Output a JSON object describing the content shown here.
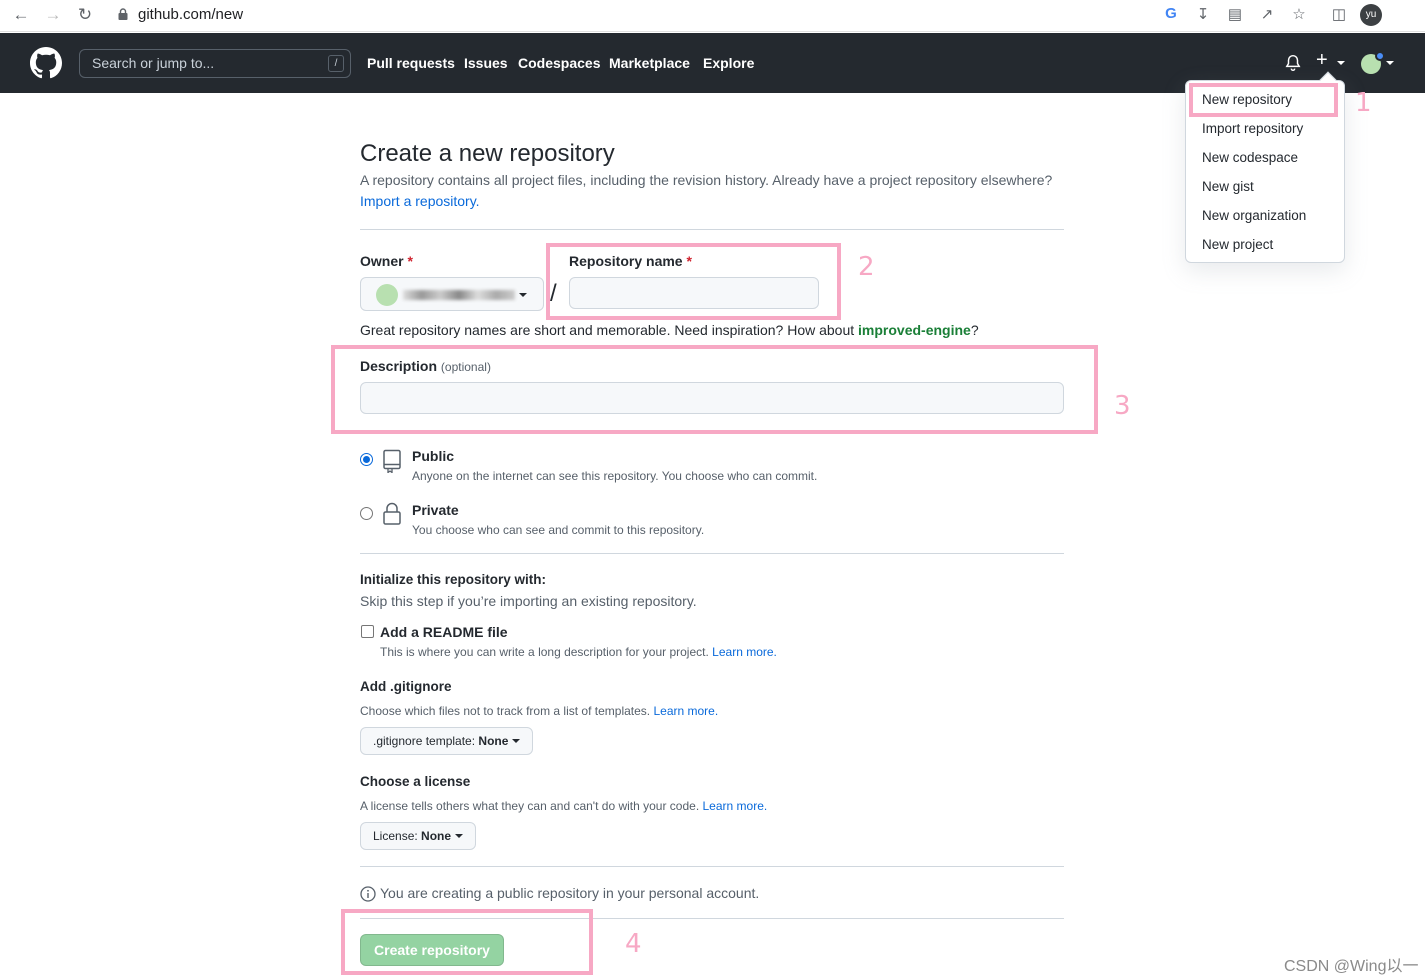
{
  "browser": {
    "url": "github.com/new",
    "profile_initials": "yu"
  },
  "header": {
    "search_placeholder": "Search or jump to...",
    "search_shortcut": "/",
    "nav": [
      "Pull requests",
      "Issues",
      "Codespaces",
      "Marketplace",
      "Explore"
    ],
    "plus_label": "+"
  },
  "dropdown": {
    "items": [
      "New repository",
      "Import repository",
      "New codespace",
      "New gist",
      "New organization",
      "New project"
    ]
  },
  "page": {
    "title": "Create a new repository",
    "subtitle": "A repository contains all project files, including the revision history. Already have a project repository elsewhere?",
    "import_link": "Import a repository.",
    "owner_label": "Owner",
    "required_mark": "*",
    "repo_name_label": "Repository name",
    "separator": "/",
    "repo_name_value": "",
    "hint_prefix": "Great repository names are short and memorable. Need inspiration? How about",
    "hint_suggestion": "improved-engine",
    "hint_suffix": "?",
    "description_label": "Description",
    "description_optional": "(optional)",
    "description_value": "",
    "visibility": {
      "selected": "Public",
      "public_title": "Public",
      "public_desc": "Anyone on the internet can see this repository. You choose who can commit.",
      "private_title": "Private",
      "private_desc": "You choose who can see and commit to this repository."
    },
    "init_title": "Initialize this repository with:",
    "init_sub": "Skip this step if you’re importing an existing repository.",
    "readme_label": "Add a README file",
    "readme_desc": "This is where you can write a long description for your project.",
    "learn_more": "Learn more.",
    "gitignore_title": "Add .gitignore",
    "gitignore_desc": "Choose which files not to track from a list of templates.",
    "gitignore_btn_prefix": ".gitignore template:",
    "gitignore_btn_value": "None",
    "license_title": "Choose a license",
    "license_desc": "A license tells others what they can and can't do with your code.",
    "license_btn_prefix": "License:",
    "license_btn_value": "None",
    "notice": "You are creating a public repository in your personal account.",
    "create_button": "Create repository"
  },
  "annotations": [
    "1",
    "2",
    "3",
    "4"
  ],
  "watermark": "CSDN @Wing以一",
  "colors": {
    "header_bg": "#24292f",
    "link": "#0969da",
    "green": "#1a7f37",
    "create_btn": "#94d3a2",
    "annotation": "#f7a8c4"
  }
}
